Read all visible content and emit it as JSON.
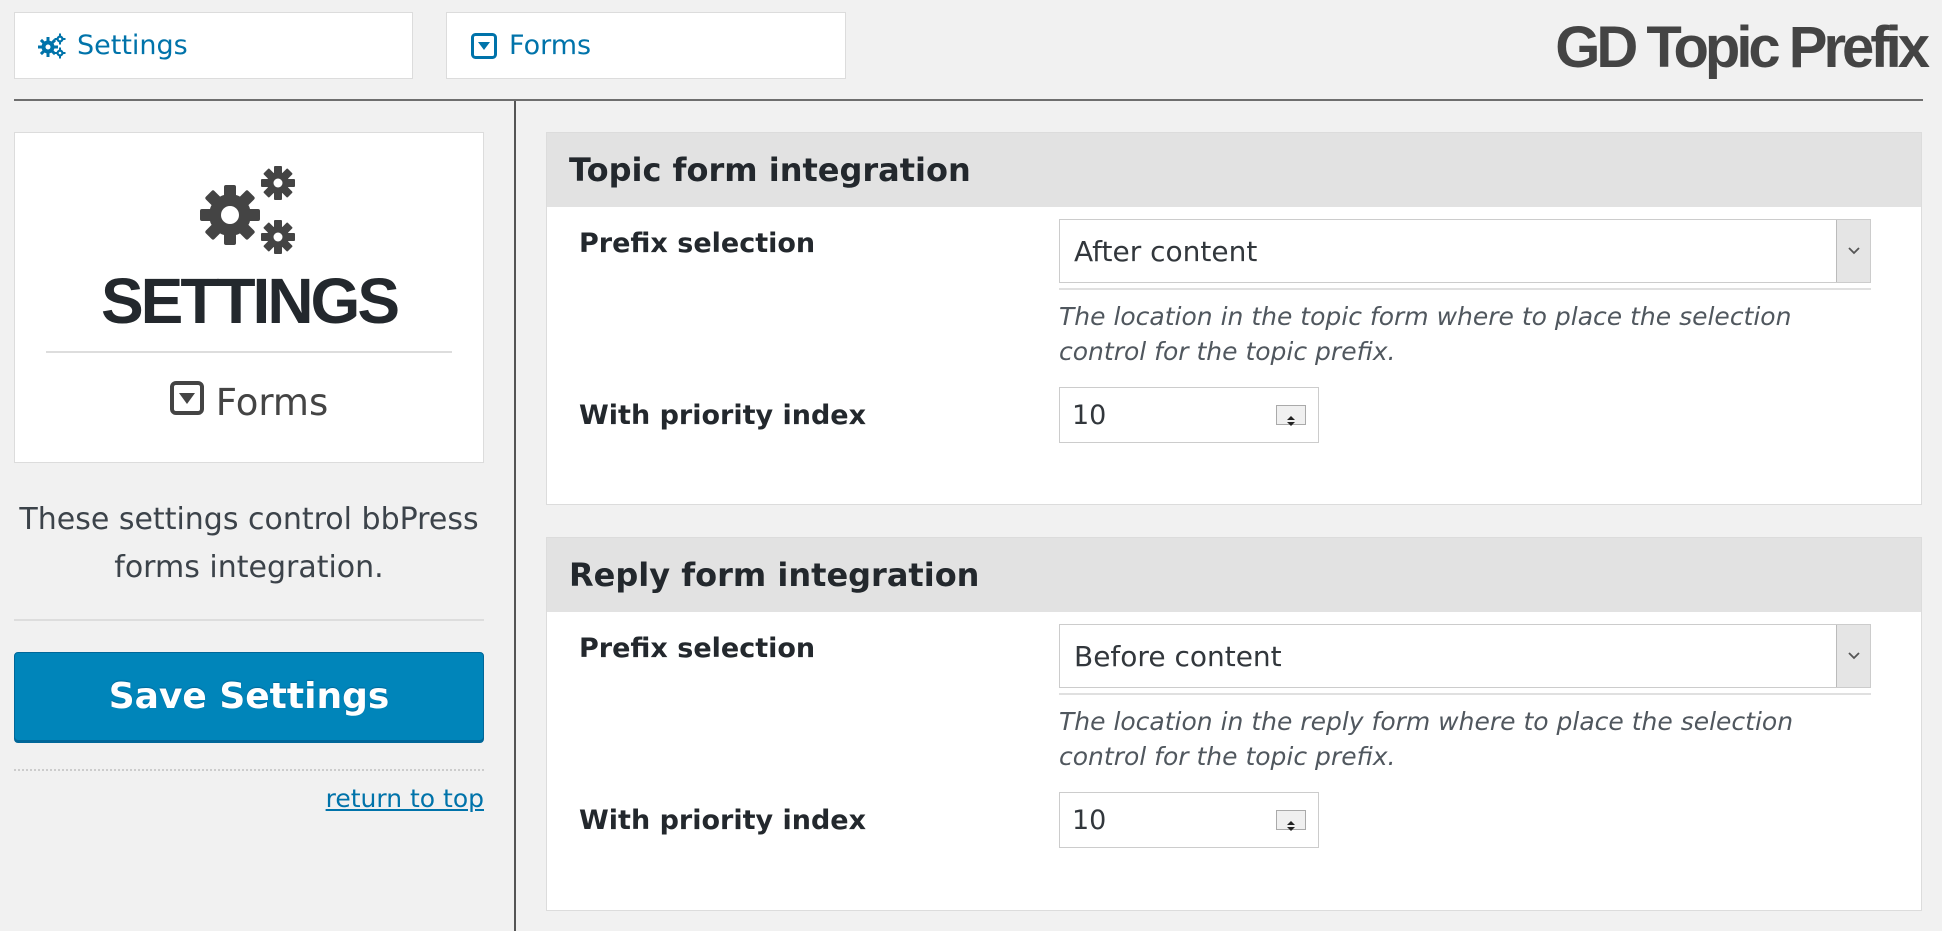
{
  "nav": {
    "settings_label": "Settings",
    "forms_label": "Forms"
  },
  "brand": "GD Topic Prefix",
  "panel": {
    "title": "SETTINGS",
    "section": "Forms",
    "description": "These settings control bbPress forms integration.",
    "save_label": "Save Settings",
    "return_label": "return to top"
  },
  "icons": {
    "settings_tab": "gears-icon",
    "forms_tab": "caret-square-down-icon",
    "panel_main": "gears-icon",
    "panel_section": "caret-square-down-icon"
  },
  "colors": {
    "accent": "#0073aa",
    "button": "#0085ba"
  },
  "groups": {
    "topic": {
      "title": "Topic form integration",
      "prefix_label": "Prefix selection",
      "prefix_value": "After content",
      "prefix_desc": "The location in the topic form where to place the selection control for the topic prefix.",
      "priority_label": "With priority index",
      "priority_value": "10"
    },
    "reply": {
      "title": "Reply form integration",
      "prefix_label": "Prefix selection",
      "prefix_value": "Before content",
      "prefix_desc": "The location in the reply form where to place the selection control for the topic prefix.",
      "priority_label": "With priority index",
      "priority_value": "10"
    }
  }
}
